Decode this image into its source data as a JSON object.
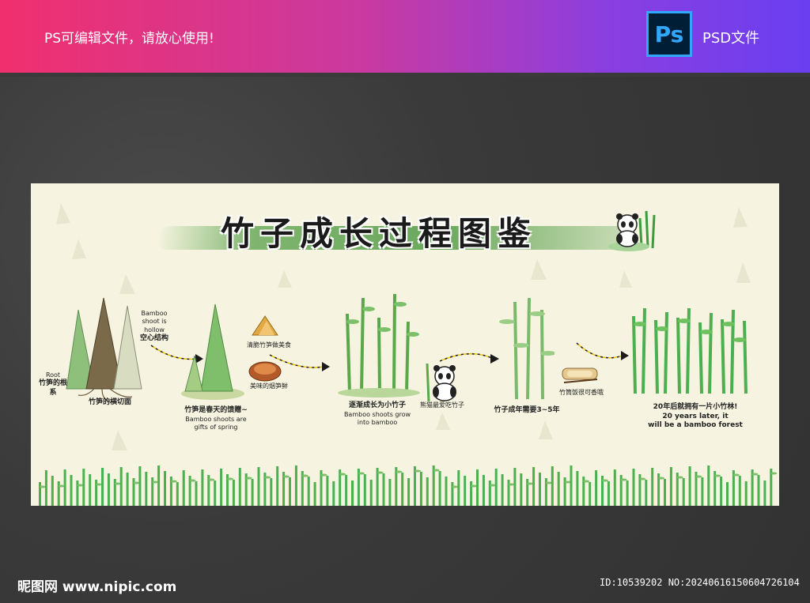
{
  "banner": {
    "left_text": "PS可编辑文件，请放心使用!",
    "ps_icon_text": "Ps",
    "right_text": "PSD文件"
  },
  "board": {
    "title": "竹子成长过程图鉴",
    "stage1": {
      "root_label_en": "Root",
      "root_label_cn": "竹笋的根系",
      "hollow_label_en": "Bamboo shoot is hollow",
      "hollow_label_cn": "空心结构",
      "caption": "竹笋的横切面"
    },
    "stage2": {
      "food1": "清脆竹笋做美食",
      "food2": "美味的烟笋鲜",
      "caption_cn": "竹笋是春天的馈赠~",
      "caption_en": "Bamboo shoots are gifts of spring"
    },
    "stage3": {
      "caption_cn": "逐渐成长为小竹子",
      "caption_en": "Bamboo shoots grow into bamboo",
      "panda_caption": "熊猫最爱吃竹子"
    },
    "stage4": {
      "caption_cn": "竹子成年需要3~5年",
      "product_caption": "竹筒饭很可香哦"
    },
    "stage5": {
      "caption_cn": "20年后就拥有一片小竹林!",
      "caption_en_1": "20 years later, it",
      "caption_en_2": "will be a bamboo forest"
    }
  },
  "footer": {
    "left_text": "昵图网 www.nipic.com",
    "right_text": "ID:10539202 NO:20240616150604726104"
  },
  "colors": {
    "banner_start": "#f0306e",
    "banner_end": "#6a3ff0",
    "board_bg": "#f6f4e0",
    "bamboo_green": "#4caf50",
    "arrow_yellow": "#f2c500"
  }
}
